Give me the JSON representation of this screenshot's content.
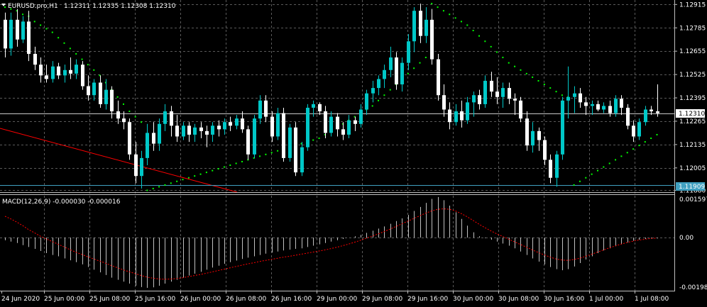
{
  "header": {
    "symbol_label": "EURUSD.pro,H1",
    "ohlc": "1.12311 1.12335 1.12308 1.12310",
    "macd_label": "MACD(12,26,9) -0.000030 -0.000016"
  },
  "colors": {
    "background": "#000000",
    "grid": "#5a5a5a",
    "candle_bull": "#00c8c8",
    "candle_bear": "#ffffff",
    "sar": "#00ff00",
    "trendline": "#ff0000",
    "hline": "#40a0c0",
    "macd_hist": "#c0c0c0",
    "macd_signal": "#ff0000",
    "text": "#ffffff"
  },
  "chart_data": {
    "type": "candlestick",
    "symbol": "EURUSD.pro",
    "timeframe": "H1",
    "ylim": [
      1.1187,
      1.1294
    ],
    "y_ticks": [
      "1.12915",
      "1.12785",
      "1.12655",
      "1.12525",
      "1.12395",
      "1.12265",
      "1.12135",
      "1.12005",
      "1.11880"
    ],
    "x_labels": [
      "24 Jun 2020",
      "25 Jun 00:00",
      "25 Jun 08:00",
      "25 Jun 16:00",
      "26 Jun 00:00",
      "26 Jun 08:00",
      "26 Jun 16:00",
      "29 Jun 00:00",
      "29 Jun 08:00",
      "29 Jun 16:00",
      "30 Jun 00:00",
      "30 Jun 08:00",
      "30 Jun 16:00",
      "1 Jul 00:00",
      "1 Jul 08:00"
    ],
    "current_price_label": "1.12310",
    "hline_price_label": "1.11909",
    "candles": [
      [
        1.1283,
        1.1287,
        1.1262,
        1.1267
      ],
      [
        1.1267,
        1.1287,
        1.1263,
        1.1283
      ],
      [
        1.1283,
        1.1289,
        1.1268,
        1.1272
      ],
      [
        1.1272,
        1.1285,
        1.127,
        1.1282
      ],
      [
        1.1282,
        1.1288,
        1.126,
        1.1264
      ],
      [
        1.1264,
        1.1268,
        1.1255,
        1.1258
      ],
      [
        1.1258,
        1.1262,
        1.1248,
        1.1252
      ],
      [
        1.1252,
        1.1258,
        1.1248,
        1.125
      ],
      [
        1.125,
        1.126,
        1.1248,
        1.1257
      ],
      [
        1.1257,
        1.1259,
        1.125,
        1.1252
      ],
      [
        1.1252,
        1.1258,
        1.1248,
        1.1255
      ],
      [
        1.1255,
        1.1262,
        1.125,
        1.1253
      ],
      [
        1.1253,
        1.1261,
        1.125,
        1.1258
      ],
      [
        1.1258,
        1.126,
        1.1244,
        1.1246
      ],
      [
        1.1246,
        1.1252,
        1.1238,
        1.1241
      ],
      [
        1.1241,
        1.125,
        1.1238,
        1.1248
      ],
      [
        1.1248,
        1.1252,
        1.1234,
        1.1236
      ],
      [
        1.1236,
        1.125,
        1.1233,
        1.1244
      ],
      [
        1.1244,
        1.1246,
        1.1228,
        1.1232
      ],
      [
        1.1232,
        1.1238,
        1.1225,
        1.1228
      ],
      [
        1.1228,
        1.1232,
        1.1222,
        1.1226
      ],
      [
        1.1226,
        1.1228,
        1.1205,
        1.1208
      ],
      [
        1.1208,
        1.1215,
        1.1192,
        1.1196
      ],
      [
        1.1196,
        1.121,
        1.1189,
        1.1206
      ],
      [
        1.1206,
        1.1225,
        1.1202,
        1.122
      ],
      [
        1.122,
        1.1226,
        1.121,
        1.1214
      ],
      [
        1.1214,
        1.1228,
        1.121,
        1.1225
      ],
      [
        1.1225,
        1.1236,
        1.1221,
        1.1232
      ],
      [
        1.1232,
        1.1235,
        1.1218,
        1.1224
      ],
      [
        1.1224,
        1.123,
        1.1215,
        1.1218
      ],
      [
        1.1218,
        1.1226,
        1.1216,
        1.1224
      ],
      [
        1.1224,
        1.1226,
        1.1215,
        1.1219
      ],
      [
        1.1219,
        1.1225,
        1.1215,
        1.1223
      ],
      [
        1.1223,
        1.1226,
        1.1217,
        1.1221
      ],
      [
        1.1221,
        1.1224,
        1.1212,
        1.1219
      ],
      [
        1.1219,
        1.1226,
        1.1215,
        1.1224
      ],
      [
        1.1224,
        1.1227,
        1.1218,
        1.1222
      ],
      [
        1.1222,
        1.1228,
        1.1219,
        1.1226
      ],
      [
        1.1226,
        1.1229,
        1.1221,
        1.1224
      ],
      [
        1.1224,
        1.123,
        1.1222,
        1.1228
      ],
      [
        1.1228,
        1.1232,
        1.122,
        1.1222
      ],
      [
        1.1222,
        1.1224,
        1.1205,
        1.1208
      ],
      [
        1.1208,
        1.123,
        1.1206,
        1.1228
      ],
      [
        1.1228,
        1.1241,
        1.1225,
        1.1238
      ],
      [
        1.1238,
        1.1241,
        1.1226,
        1.1229
      ],
      [
        1.1229,
        1.1232,
        1.1215,
        1.1218
      ],
      [
        1.1218,
        1.1234,
        1.1216,
        1.1231
      ],
      [
        1.1231,
        1.1234,
        1.1204,
        1.1206
      ],
      [
        1.1206,
        1.1225,
        1.1204,
        1.1223
      ],
      [
        1.1223,
        1.1226,
        1.1196,
        1.1198
      ],
      [
        1.1198,
        1.1215,
        1.1196,
        1.1212
      ],
      [
        1.1212,
        1.1236,
        1.121,
        1.1234
      ],
      [
        1.1234,
        1.1238,
        1.1229,
        1.1236
      ],
      [
        1.1236,
        1.1237,
        1.123,
        1.1232
      ],
      [
        1.1232,
        1.1235,
        1.1217,
        1.122
      ],
      [
        1.122,
        1.1232,
        1.1218,
        1.1229
      ],
      [
        1.1229,
        1.1231,
        1.1218,
        1.1222
      ],
      [
        1.1222,
        1.1226,
        1.1216,
        1.1219
      ],
      [
        1.1219,
        1.123,
        1.1217,
        1.1227
      ],
      [
        1.1227,
        1.1229,
        1.1221,
        1.1225
      ],
      [
        1.1225,
        1.1236,
        1.1223,
        1.1233
      ],
      [
        1.1233,
        1.1244,
        1.123,
        1.1242
      ],
      [
        1.1242,
        1.1249,
        1.1237,
        1.1245
      ],
      [
        1.1245,
        1.1252,
        1.1241,
        1.125
      ],
      [
        1.125,
        1.1258,
        1.1245,
        1.1255
      ],
      [
        1.1255,
        1.1268,
        1.1251,
        1.1262
      ],
      [
        1.1262,
        1.1265,
        1.1244,
        1.1247
      ],
      [
        1.1247,
        1.1262,
        1.1243,
        1.1259
      ],
      [
        1.1259,
        1.1275,
        1.1255,
        1.1271
      ],
      [
        1.1271,
        1.129,
        1.1265,
        1.1288
      ],
      [
        1.1288,
        1.1292,
        1.127,
        1.1274
      ],
      [
        1.1274,
        1.129,
        1.127,
        1.1283
      ],
      [
        1.1283,
        1.1289,
        1.1258,
        1.1261
      ],
      [
        1.1261,
        1.1264,
        1.1238,
        1.1241
      ],
      [
        1.1241,
        1.1247,
        1.1229,
        1.1233
      ],
      [
        1.1233,
        1.1237,
        1.1222,
        1.1226
      ],
      [
        1.1226,
        1.1236,
        1.1224,
        1.1232
      ],
      [
        1.1232,
        1.1238,
        1.1223,
        1.1227
      ],
      [
        1.1227,
        1.124,
        1.1225,
        1.1237
      ],
      [
        1.1237,
        1.1243,
        1.1229,
        1.1241
      ],
      [
        1.1241,
        1.1244,
        1.1233,
        1.1236
      ],
      [
        1.1236,
        1.1252,
        1.1234,
        1.1249
      ],
      [
        1.1249,
        1.1254,
        1.124,
        1.1243
      ],
      [
        1.1243,
        1.1251,
        1.1236,
        1.124
      ],
      [
        1.124,
        1.1248,
        1.1234,
        1.1245
      ],
      [
        1.1245,
        1.1248,
        1.1236,
        1.1239
      ],
      [
        1.1239,
        1.1242,
        1.123,
        1.1238
      ],
      [
        1.1238,
        1.124,
        1.1226,
        1.1228
      ],
      [
        1.1228,
        1.1232,
        1.121,
        1.1213
      ],
      [
        1.1213,
        1.1226,
        1.1209,
        1.1221
      ],
      [
        1.1221,
        1.1223,
        1.121,
        1.1216
      ],
      [
        1.1216,
        1.1218,
        1.1202,
        1.1205
      ],
      [
        1.1205,
        1.1208,
        1.1192,
        1.1195
      ],
      [
        1.1195,
        1.121,
        1.119,
        1.1208
      ],
      [
        1.1208,
        1.124,
        1.1205,
        1.1238
      ],
      [
        1.1238,
        1.1257,
        1.1228,
        1.124
      ],
      [
        1.124,
        1.1246,
        1.1231,
        1.1242
      ],
      [
        1.1242,
        1.1245,
        1.1234,
        1.1237
      ],
      [
        1.1237,
        1.124,
        1.123,
        1.1235
      ],
      [
        1.1235,
        1.1238,
        1.123,
        1.1236
      ],
      [
        1.1236,
        1.1238,
        1.1232,
        1.1233
      ],
      [
        1.1233,
        1.1237,
        1.1231,
        1.1235
      ],
      [
        1.1235,
        1.1238,
        1.1229,
        1.1231
      ],
      [
        1.1231,
        1.1241,
        1.1229,
        1.1239
      ],
      [
        1.1239,
        1.1241,
        1.123,
        1.1234
      ],
      [
        1.1234,
        1.1236,
        1.1222,
        1.1224
      ],
      [
        1.1224,
        1.1227,
        1.1215,
        1.1218
      ],
      [
        1.1218,
        1.1228,
        1.1216,
        1.1226
      ],
      [
        1.1226,
        1.1235,
        1.1224,
        1.1233
      ],
      [
        1.1233,
        1.1235,
        1.123,
        1.1232
      ],
      [
        1.1232,
        1.1247,
        1.1229,
        1.1231
      ]
    ],
    "parabolic_sar": [
      1.129,
      1.1289,
      1.1288,
      1.1286,
      1.1285,
      1.1282,
      1.128,
      1.1278,
      1.1276,
      1.1273,
      1.127,
      1.1267,
      1.1264,
      1.1261,
      1.1258,
      1.1255,
      1.1252,
      1.1248,
      1.1244,
      1.124,
      1.1236,
      1.1232,
      1.1229,
      1.1226,
      1.1188,
      1.1189,
      1.119,
      1.1191,
      1.1192,
      1.1193,
      1.1194,
      1.1195,
      1.1196,
      1.1197,
      1.1198,
      1.1199,
      1.12,
      1.1201,
      1.1202,
      1.1203,
      1.1204,
      1.1205,
      1.1206,
      1.1207,
      1.1208,
      1.1209,
      1.121,
      1.1211,
      1.1212,
      1.1213,
      1.1214,
      1.1215,
      1.1216,
      1.1217,
      1.1219,
      1.1221,
      1.1223,
      1.1225,
      1.1227,
      1.1229,
      1.1231,
      1.1233,
      1.1235,
      1.1238,
      1.1241,
      1.1244,
      1.1247,
      1.125,
      1.1253,
      1.1256,
      1.1259,
      1.1262,
      1.1292,
      1.129,
      1.1288,
      1.1286,
      1.1284,
      1.1282,
      1.128,
      1.1277,
      1.1274,
      1.1271,
      1.1268,
      1.1265,
      1.1262,
      1.1259,
      1.1257,
      1.1255,
      1.1253,
      1.1251,
      1.1249,
      1.1247,
      1.1245,
      1.1243,
      1.1241,
      1.124,
      1.1191,
      1.1193,
      1.1195,
      1.1197,
      1.1199,
      1.1201,
      1.1203,
      1.1205,
      1.1207,
      1.1209,
      1.1211,
      1.1213,
      1.1215,
      1.1217,
      1.1219
    ],
    "macd": {
      "params": "12,26,9",
      "ylim": [
        -0.001987,
        0.001597
      ],
      "y_ticks": [
        "0.001597",
        "0.00",
        "-0.001987"
      ],
      "main_value": "-0.000030",
      "signal_value": "-0.000016",
      "histogram": [
        -0.0001,
        -0.00015,
        -0.0002,
        -0.00028,
        -0.00035,
        -0.00042,
        -0.0005,
        -0.00058,
        -0.00065,
        -0.0007,
        -0.00078,
        -0.00085,
        -0.00092,
        -0.001,
        -0.0011,
        -0.0012,
        -0.0013,
        -0.0014,
        -0.0015,
        -0.00158,
        -0.00165,
        -0.00172,
        -0.0018,
        -0.00185,
        -0.00188,
        -0.00186,
        -0.0018,
        -0.00172,
        -0.00165,
        -0.00158,
        -0.0015,
        -0.00142,
        -0.00135,
        -0.00128,
        -0.0012,
        -0.00112,
        -0.00105,
        -0.00098,
        -0.00092,
        -0.00086,
        -0.0008,
        -0.00075,
        -0.0007,
        -0.00065,
        -0.0006,
        -0.00056,
        -0.00052,
        -0.00048,
        -0.00045,
        -0.00042,
        -0.0004,
        -0.00035,
        -0.0003,
        -0.00025,
        -0.0002,
        -0.00015,
        -0.0001,
        -5e-05,
        0.0,
        5e-05,
        0.0001,
        0.00018,
        0.00026,
        0.00034,
        0.00042,
        0.00052,
        0.00062,
        0.00072,
        0.00085,
        0.001,
        0.00115,
        0.0013,
        0.00145,
        0.00152,
        0.0014,
        0.0012,
        0.00095,
        0.0007,
        0.00045,
        0.0002,
        5e-05,
        -2e-05,
        -8e-05,
        -0.00015,
        -0.00022,
        -0.0003,
        -0.0004,
        -0.00052,
        -0.00065,
        -0.00078,
        -0.0009,
        -0.001,
        -0.0011,
        -0.00118,
        -0.00122,
        -0.00118,
        -0.00108,
        -0.00095,
        -0.00082,
        -0.0007,
        -0.00058,
        -0.00048,
        -0.0004,
        -0.00032,
        -0.00025,
        -0.00018,
        -0.00012,
        -8e-05,
        -5e-05,
        -3e-05,
        -3e-05
      ],
      "signal": [
        0.0008,
        0.0007,
        0.00058,
        0.00045,
        0.0003,
        0.00018,
        5e-05,
        -5e-05,
        -0.00015,
        -0.00025,
        -0.00035,
        -0.00045,
        -0.00055,
        -0.00063,
        -0.00072,
        -0.0008,
        -0.00088,
        -0.00096,
        -0.00105,
        -0.00113,
        -0.00121,
        -0.00128,
        -0.00135,
        -0.00142,
        -0.00148,
        -0.00152,
        -0.00155,
        -0.00156,
        -0.00155,
        -0.00153,
        -0.0015,
        -0.00146,
        -0.00142,
        -0.00138,
        -0.00133,
        -0.00128,
        -0.00123,
        -0.00118,
        -0.00113,
        -0.00108,
        -0.00103,
        -0.00098,
        -0.00094,
        -0.00089,
        -0.00085,
        -0.00081,
        -0.00077,
        -0.00073,
        -0.0007,
        -0.00066,
        -0.00062,
        -0.00058,
        -0.00054,
        -0.0005,
        -0.00046,
        -0.00041,
        -0.00036,
        -0.0003,
        -0.00024,
        -0.00017,
        -0.0001,
        -2e-05,
        6e-05,
        0.00014,
        0.00023,
        0.00032,
        0.00042,
        0.00052,
        0.00062,
        0.00072,
        0.00082,
        0.00092,
        0.001,
        0.00106,
        0.00108,
        0.00106,
        0.001,
        0.0009,
        0.00078,
        0.00064,
        0.0005,
        0.00037,
        0.00025,
        0.00014,
        4e-05,
        -6e-05,
        -0.00016,
        -0.00026,
        -0.00036,
        -0.00046,
        -0.00056,
        -0.00065,
        -0.00073,
        -0.0008,
        -0.00084,
        -0.00085,
        -0.00082,
        -0.00077,
        -0.0007,
        -0.00062,
        -0.00054,
        -0.00046,
        -0.00038,
        -0.00031,
        -0.00024,
        -0.00018,
        -0.00013,
        -9e-05,
        -6e-05,
        -3e-05,
        -2e-05
      ]
    }
  }
}
